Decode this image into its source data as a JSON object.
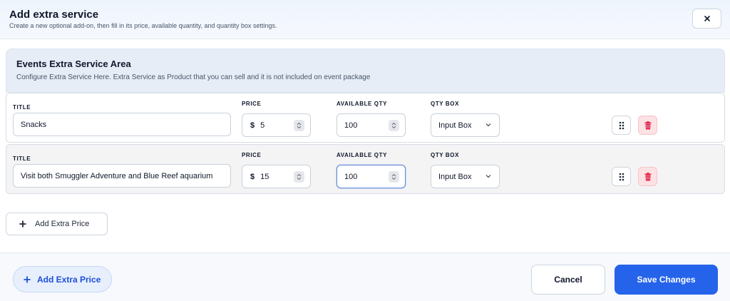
{
  "header": {
    "title": "Add extra service",
    "subtitle": "Create a new optional add-on, then fill in its price, available quantity, and quantity box settings.",
    "close_icon": "close-icon"
  },
  "area": {
    "title": "Events Extra Service Area",
    "subtitle": "Configure Extra Service Here. Extra Service as Product that you can sell and it is not included on event package"
  },
  "columns": {
    "title": "TITLE",
    "price": "PRICE",
    "available_qty": "AVAILABLE QTY",
    "qty_box": "QTY BOX"
  },
  "rows": [
    {
      "title": "Snacks",
      "currency": "$",
      "price": "5",
      "available_qty": "100",
      "qty_box": "Input Box"
    },
    {
      "title": "Visit both Smuggler Adventure and   Blue Reef aquarium",
      "currency": "$",
      "price": "15",
      "available_qty": "100",
      "qty_box": "Input Box"
    }
  ],
  "add_inline_label": "Add Extra Price",
  "footer": {
    "add_label": "Add Extra Price",
    "cancel_label": "Cancel",
    "save_label": "Save Changes"
  },
  "colors": {
    "accent": "#2563eb",
    "delete": "#e11d48"
  }
}
